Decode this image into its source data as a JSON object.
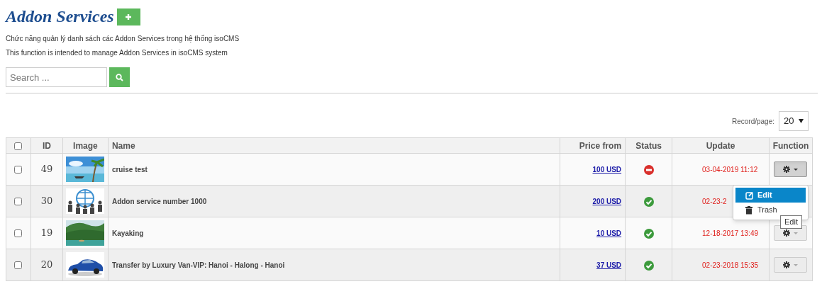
{
  "title": "Addon Services",
  "descriptions": [
    "Chức năng quản lý danh sách các Addon Services trong hệ thống isoCMS",
    "This function is intended to manage Addon Services in isoCMS system"
  ],
  "search": {
    "placeholder": "Search ..."
  },
  "pagination": {
    "label": "Record/page:",
    "value": "20"
  },
  "table": {
    "select_all": {
      "checked": false
    },
    "columns": [
      "ID",
      "Image",
      "Name",
      "Price from",
      "Status",
      "Update",
      "Function"
    ],
    "rows": [
      {
        "checked": false,
        "id": "49",
        "name": "cruise test",
        "price": "100 USD",
        "active": false,
        "update": "03-04-2019 11:12",
        "button": true,
        "expanded": true
      },
      {
        "checked": false,
        "id": "30",
        "name": "Addon service number 1000",
        "price": "200 USD",
        "active": true,
        "update": "02-23-2",
        "button": false
      },
      {
        "checked": false,
        "id": "19",
        "name": "Kayaking",
        "price": "10 USD",
        "active": true,
        "update": "12-18-2017 13:49",
        "button": true,
        "expanded": false
      },
      {
        "checked": false,
        "id": "20",
        "name": "Transfer by Luxury Van-VIP: Hanoi - Halong - Hanoi",
        "price": "37 USD",
        "active": true,
        "update": "02-23-2018 15:35",
        "button": true,
        "expanded": false
      }
    ]
  },
  "function_menu": {
    "items": [
      {
        "kind": "edit",
        "label": "Edit",
        "selected": true
      },
      {
        "kind": "trash",
        "label": "Trash",
        "selected": false
      }
    ],
    "tooltip": "Edit"
  }
}
